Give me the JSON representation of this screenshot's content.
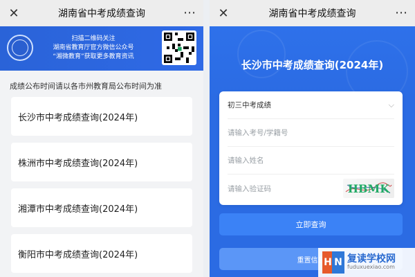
{
  "left": {
    "title": "湖南省中考成绩查询",
    "close_glyph": "✕",
    "more_glyph": "⋯",
    "banner": {
      "line1": "扫描二维码关注",
      "line2": "湖南省教育厅官方微信公众号",
      "line3": "“湘微教育”获取更多教育资讯"
    },
    "note": "成绩公布时间请以各市州教育局公布时间为准",
    "cities": [
      "长沙市中考成绩查询(2024年)",
      "株洲市中考成绩查询(2024年)",
      "湘潭市中考成绩查询(2024年)",
      "衡阳市中考成绩查询(2024年)"
    ]
  },
  "right": {
    "title": "湖南省中考成绩查询",
    "close_glyph": "✕",
    "more_glyph": "⋯",
    "hero_title": "长沙市中考成绩查询(2024年)",
    "form": {
      "select_value": "初三中考成绩",
      "exam_placeholder": "请输入考号/学籍号",
      "name_placeholder": "请输入姓名",
      "captcha_placeholder": "请输入验证码",
      "captcha_text": "HBMK"
    },
    "submit_label": "立即查询",
    "reset_label": "重置信息"
  },
  "watermark": {
    "mark_left": "H",
    "mark_right": "N",
    "cn": "复读学校网",
    "en": "fuduxuexiao.com"
  },
  "colors": {
    "brand_blue": "#2b6be3",
    "button_blue": "#3b82f6"
  }
}
